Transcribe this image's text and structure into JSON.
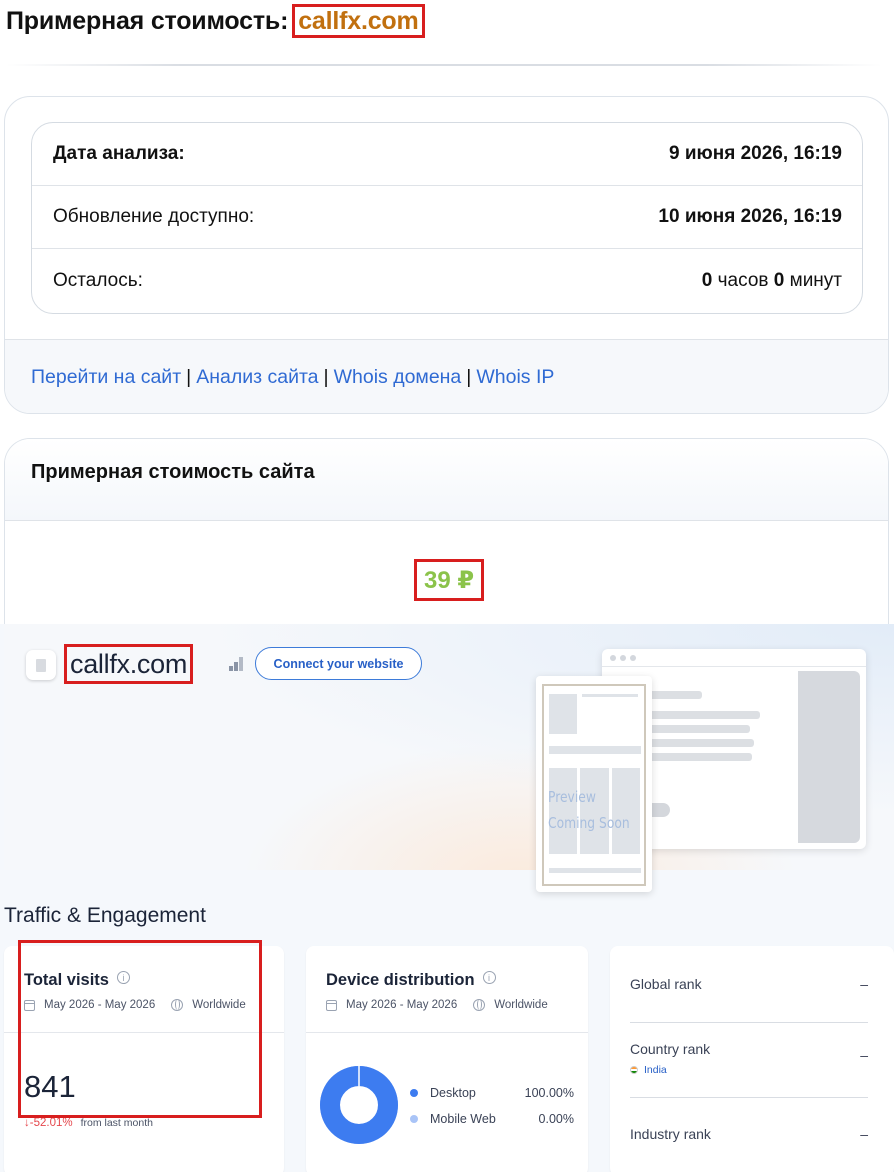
{
  "title": {
    "prefix": "Примерная стоимость:",
    "domain": "callfx.com"
  },
  "analysis": {
    "rows": [
      {
        "label": "Дата анализа:",
        "value": "9 июня 2026, 16:19"
      },
      {
        "label": "Обновление доступно:",
        "value": "10 июня 2026, 16:19"
      }
    ],
    "remaining": {
      "label": "Осталось:",
      "hours": "0",
      "hours_unit": "часов",
      "minutes": "0",
      "minutes_unit": "минут"
    }
  },
  "links": [
    "Перейти на сайт",
    "Анализ сайта",
    "Whois домена",
    "Whois IP"
  ],
  "link_separator": "|",
  "estimate": {
    "heading": "Примерная стоимость сайта",
    "price": "39 ₽"
  },
  "similarweb": {
    "domain": "callfx.com",
    "connect_button": "Connect your website",
    "preview": {
      "line1": "Preview",
      "line2": "Coming Soon"
    },
    "section_title": "Traffic & Engagement",
    "total_visits": {
      "title": "Total visits",
      "date_range": "May 2026 - May 2026",
      "region": "Worldwide",
      "value": "841",
      "change": "↓-52.01%",
      "change_label": "from last month"
    },
    "device": {
      "title": "Device distribution",
      "date_range": "May 2026 - May 2026",
      "region": "Worldwide",
      "items": [
        {
          "name": "Desktop",
          "value": "100.00%",
          "color": "#3d7cf0"
        },
        {
          "name": "Mobile Web",
          "value": "0.00%",
          "color": "#a9c4f7"
        }
      ],
      "desktop_share": 1.0
    },
    "ranks": {
      "global_label": "Global rank",
      "global_value": "–",
      "country_label": "Country rank",
      "country_name": "India",
      "country_value": "–",
      "industry_label": "Industry rank",
      "industry_value": "–"
    }
  },
  "colors": {
    "highlight": "#d81e1e",
    "domain_title": "#c1700f",
    "price": "#8bc34a",
    "link": "#2f6ad3"
  }
}
